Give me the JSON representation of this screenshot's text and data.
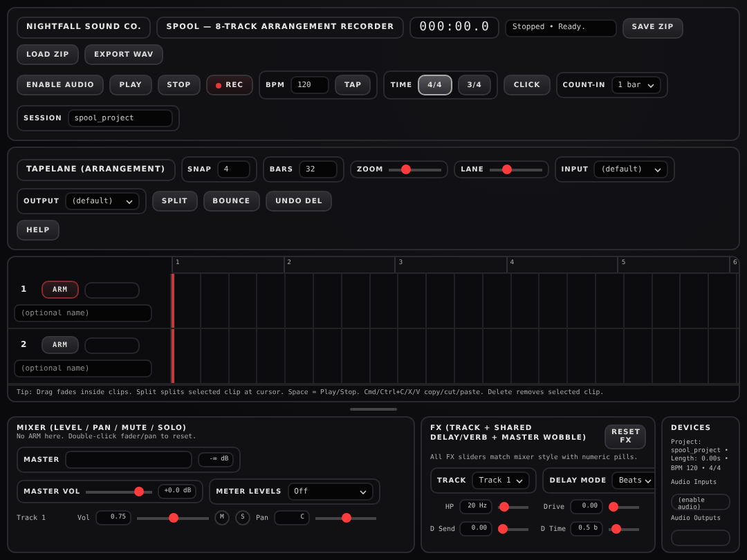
{
  "header": {
    "brand": "NIGHTFALL SOUND CO.",
    "title": "SPOOL — 8-TRACK ARRANGEMENT RECORDER",
    "clock": "000:00.0",
    "status": "Stopped • Ready.",
    "file_buttons": [
      "SAVE ZIP",
      "LOAD ZIP",
      "EXPORT WAV"
    ]
  },
  "transport": {
    "buttons": [
      {
        "label": "ENABLE AUDIO",
        "kind": "plain"
      },
      {
        "label": "PLAY",
        "kind": "plain"
      },
      {
        "label": "STOP",
        "kind": "plain"
      },
      {
        "label": "REC",
        "kind": "record"
      }
    ],
    "bpm": {
      "label": "BPM",
      "value": "120",
      "tap": "TAP"
    },
    "time": {
      "label": "TIME",
      "options": [
        {
          "label": "4/4",
          "selected": true
        },
        {
          "label": "3/4",
          "selected": false
        }
      ]
    },
    "click": "CLICK",
    "count_in": {
      "label": "COUNT-IN",
      "value": "1 bar"
    },
    "session": {
      "label": "SESSION",
      "value": "spool_project"
    }
  },
  "tapelane": {
    "title": "TAPELANE (ARRANGEMENT)",
    "snap": {
      "label": "SNAP",
      "value": "4"
    },
    "bars": {
      "label": "BARS",
      "value": "32"
    },
    "zoom": {
      "label": "ZOOM",
      "level": 0.3
    },
    "lane": {
      "label": "LANE",
      "level": 0.3
    },
    "input": {
      "label": "INPUT",
      "value": "(default)"
    },
    "output": {
      "label": "OUTPUT",
      "value": "(default)"
    },
    "buttons": [
      "SPLIT",
      "BOUNCE",
      "UNDO DEL",
      "HELP"
    ]
  },
  "timeline": {
    "ruler": [
      "1",
      "2",
      "3",
      "4",
      "5",
      "6"
    ],
    "tracks": [
      {
        "number": "1",
        "arm": "ARM",
        "armed": true,
        "name_placeholder": "(optional name)"
      },
      {
        "number": "2",
        "arm": "ARM",
        "armed": false,
        "name_placeholder": "(optional name)"
      }
    ],
    "tip": "Tip: Drag fades inside clips. Split splits selected clip at cursor. Space = Play/Stop. Cmd/Ctrl+C/X/V copy/cut/paste. Delete removes selected clip."
  },
  "mixer": {
    "title": "MIXER (LEVEL / PAN / MUTE / SOLO)",
    "subtitle": "No ARM here. Double-click fader/pan to reset.",
    "master": {
      "label": "MASTER",
      "reading": "-∞ dB"
    },
    "master_vol": {
      "label": "MASTER VOL",
      "level": 0.85,
      "reading": "+0.0 dB"
    },
    "meter_levels": {
      "label": "METER LEVELS",
      "value": "Off"
    },
    "tracks": [
      {
        "name": "Track 1",
        "volume": {
          "label": "Vol",
          "value": "0.75",
          "level": 0.5
        },
        "mute": "M",
        "solo": "S",
        "pan": {
          "label": "Pan",
          "value": "C",
          "level": 0.5
        }
      }
    ]
  },
  "fx": {
    "title": "FX (TRACK + SHARED DELAY/VERB + MASTER WOBBLE)",
    "reset": "RESET FX",
    "subtitle": "All FX sliders match mixer style with numeric pills.",
    "track": {
      "label": "TRACK",
      "value": "Track 1"
    },
    "delay_mode": {
      "label": "DELAY MODE",
      "value": "Beats"
    },
    "params": [
      {
        "label": "HP",
        "value": "20 Hz",
        "level": 0.05
      },
      {
        "label": "Drive",
        "value": "0.00",
        "level": 0
      },
      {
        "label": "D Send",
        "value": "0.00",
        "level": 0
      },
      {
        "label": "D Time",
        "value": "0.5 b",
        "level": 0.1
      }
    ]
  },
  "devices": {
    "title": "DEVICES",
    "project": "Project: spool_project • Length: 0.00s • BPM 120 • 4/4",
    "inputs_label": "Audio Inputs",
    "inputs_value": "(enable audio)",
    "outputs_label": "Audio Outputs"
  }
}
